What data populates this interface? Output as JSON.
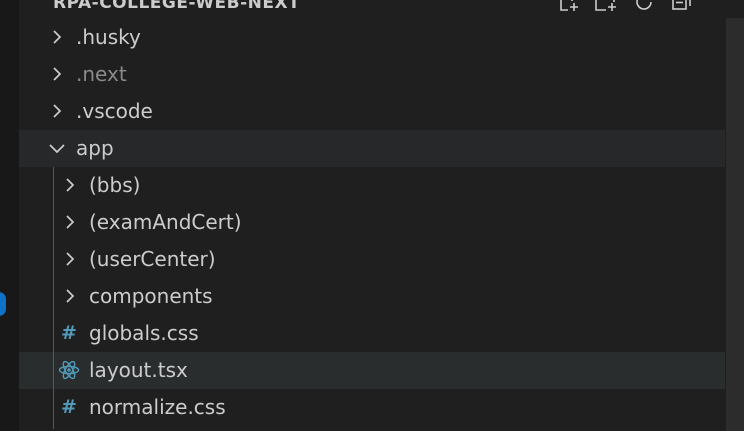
{
  "explorer": {
    "title": "RPA-COLLEGE-WEB-NEXT",
    "actions": [
      {
        "name": "new-file-icon"
      },
      {
        "name": "new-folder-icon"
      },
      {
        "name": "refresh-icon"
      },
      {
        "name": "collapse-all-icon"
      }
    ]
  },
  "tree": [
    {
      "label": ".husky",
      "type": "folder",
      "expanded": false,
      "level": 0,
      "dim": false
    },
    {
      "label": ".next",
      "type": "folder",
      "expanded": false,
      "level": 0,
      "dim": true
    },
    {
      "label": ".vscode",
      "type": "folder",
      "expanded": false,
      "level": 0,
      "dim": false
    },
    {
      "label": "app",
      "type": "folder",
      "expanded": true,
      "level": 0,
      "dim": false
    },
    {
      "label": "(bbs)",
      "type": "folder",
      "expanded": false,
      "level": 1,
      "dim": false
    },
    {
      "label": "(examAndCert)",
      "type": "folder",
      "expanded": false,
      "level": 1,
      "dim": false
    },
    {
      "label": "(userCenter)",
      "type": "folder",
      "expanded": false,
      "level": 1,
      "dim": false
    },
    {
      "label": "components",
      "type": "folder",
      "expanded": false,
      "level": 1,
      "dim": false
    },
    {
      "label": "globals.css",
      "type": "css-file",
      "level": 1,
      "icon": "css-hash-icon"
    },
    {
      "label": "layout.tsx",
      "type": "tsx-file",
      "level": 1,
      "icon": "react-icon"
    },
    {
      "label": "normalize.css",
      "type": "css-file",
      "level": 1,
      "icon": "css-hash-icon"
    }
  ],
  "colors": {
    "background": "#1f1f1f",
    "hover_row": "#2a2d2e",
    "text": "#cccccc",
    "dim_text": "#8a8a8a",
    "css_icon": "#519aba",
    "react_icon": "#519aba",
    "badge": "#0e72c9"
  }
}
